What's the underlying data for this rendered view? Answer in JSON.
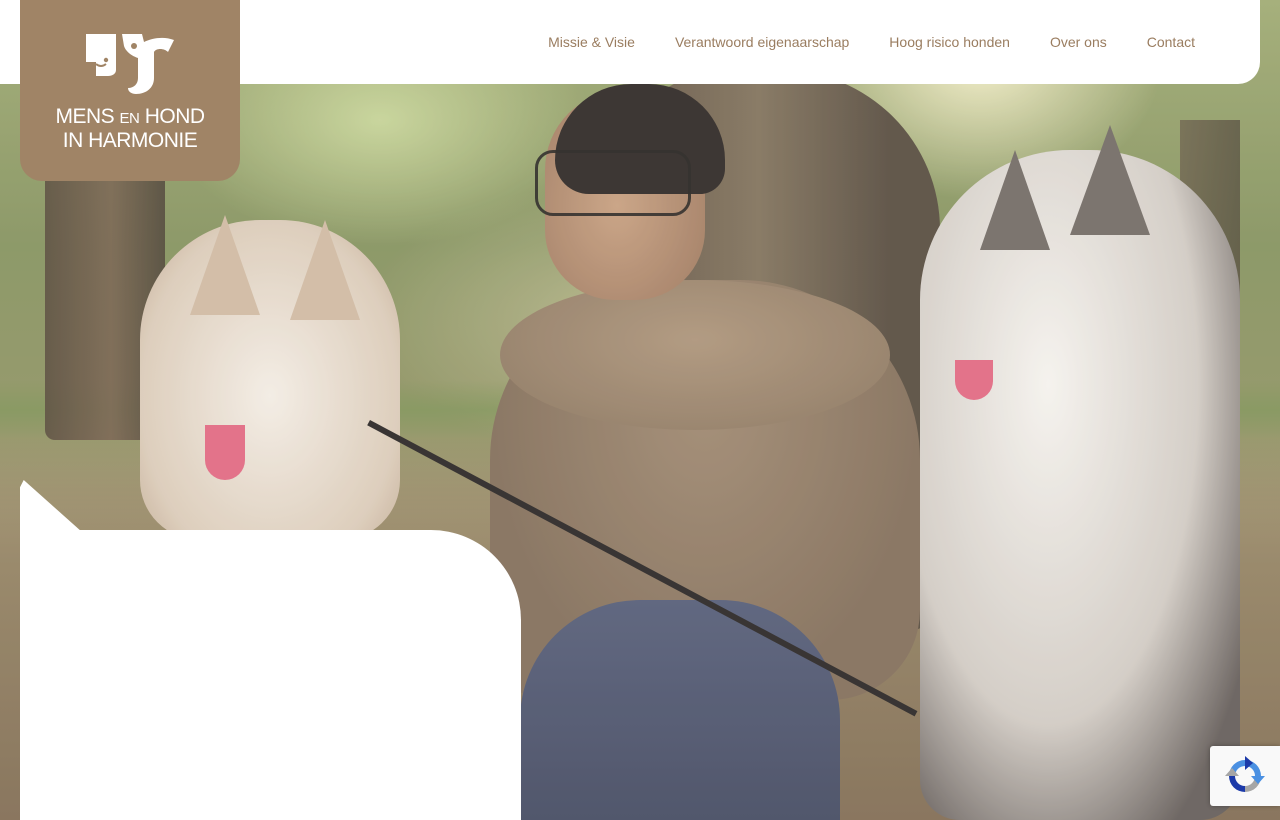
{
  "brand": {
    "line1_main": "MENS",
    "line1_small": "EN",
    "line1_end": "HOND",
    "line2": "IN HARMONIE",
    "color": "#a08466"
  },
  "nav": {
    "items": [
      {
        "label": "Missie & Visie"
      },
      {
        "label": "Verantwoord eigenaarschap"
      },
      {
        "label": "Hoog risico honden"
      },
      {
        "label": "Over ons"
      },
      {
        "label": "Contact"
      }
    ],
    "link_color": "#9a7d60"
  },
  "hero": {
    "image_icon": "photo-woman-with-two-huskies"
  },
  "recaptcha": {
    "icon": "recaptcha-icon"
  }
}
